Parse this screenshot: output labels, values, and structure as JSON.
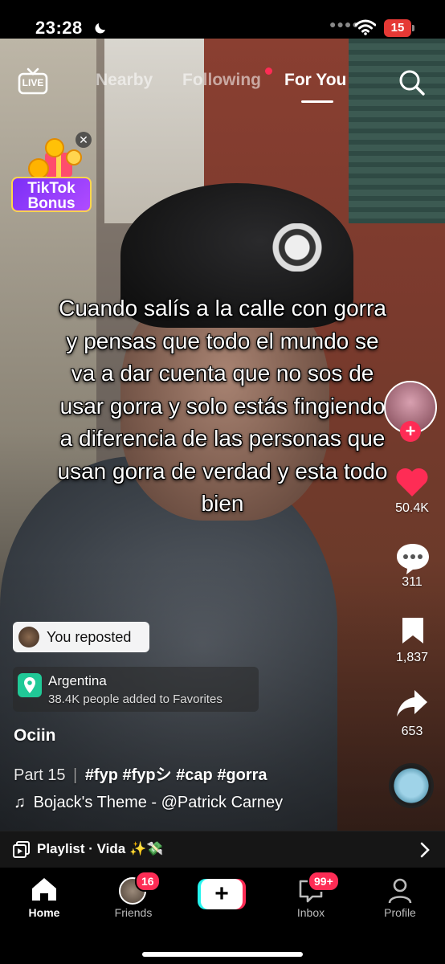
{
  "status_bar": {
    "time": "23:28",
    "battery": "15"
  },
  "top_nav": {
    "live_label": "LIVE",
    "tabs": [
      {
        "label": "Nearby",
        "active": false
      },
      {
        "label": "Following",
        "active": false
      },
      {
        "label": "For You",
        "active": true
      }
    ]
  },
  "bonus_widget": {
    "line1": "TikTok",
    "line2": "Bonus"
  },
  "video": {
    "caption": "Cuando salís a la calle con gorra y pensas que todo el mundo se va a dar cuenta que no sos de usar gorra y solo estás fingiendo a diferencia de las personas que usan gorra de verdad y esta todo bien"
  },
  "right_rail": {
    "likes": "50.4K",
    "comments": "311",
    "saves": "1,837",
    "shares": "653"
  },
  "repost_chip": {
    "label": "You reposted"
  },
  "location": {
    "name": "Argentina",
    "subtitle": "38.4K people added to Favorites"
  },
  "post": {
    "username": "Ociin",
    "part": "Part 15",
    "separator": "|",
    "hashtags": "#fyp #fypシ #cap #gorra",
    "music": "Bojack's Theme - @Patrick Carney"
  },
  "playlist": {
    "label": "Playlist · Vida ✨💸"
  },
  "bottom_nav": {
    "items": [
      {
        "label": "Home",
        "active": true
      },
      {
        "label": "Friends",
        "badge": "16"
      },
      {
        "label": ""
      },
      {
        "label": "Inbox",
        "badge": "99+"
      },
      {
        "label": "Profile"
      }
    ]
  },
  "colors": {
    "accent": "#fe2c55",
    "location_green": "#20c997"
  }
}
